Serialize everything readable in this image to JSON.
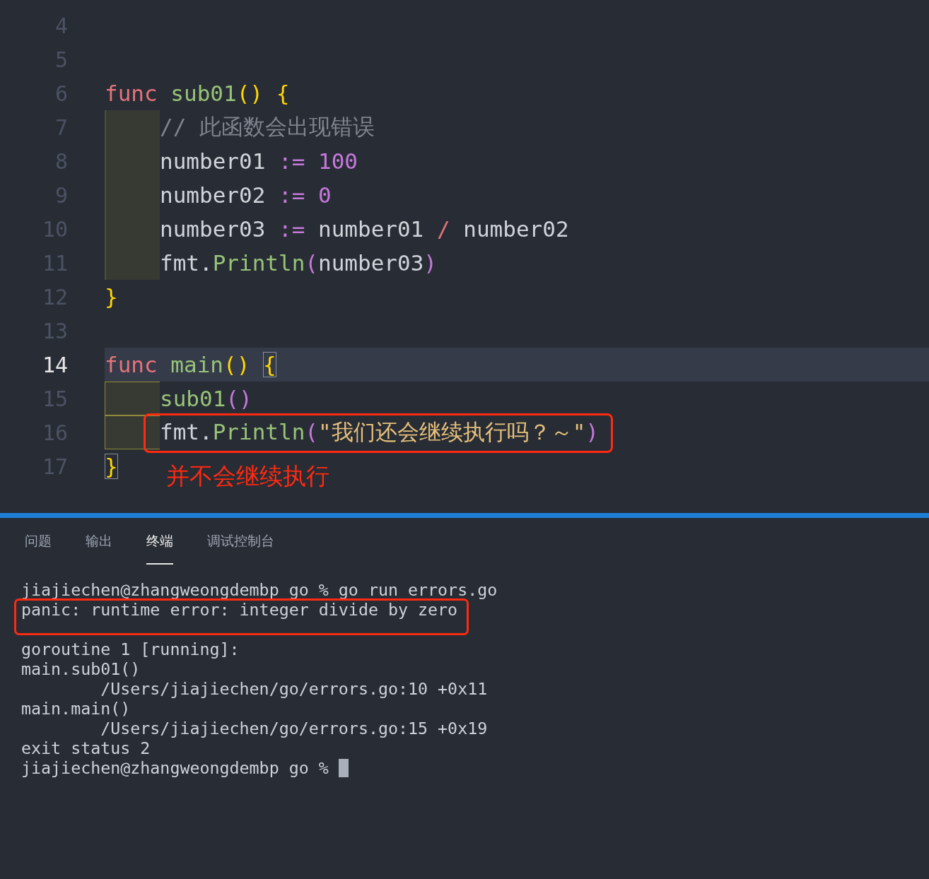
{
  "editor": {
    "lines": [
      {
        "number": "4"
      },
      {
        "number": "5"
      },
      {
        "number": "6",
        "tokens": [
          {
            "kind": "keyword",
            "text": "func "
          },
          {
            "kind": "function",
            "text": "sub01"
          },
          {
            "kind": "paren",
            "text": "() "
          },
          {
            "kind": "brace",
            "text": "{",
            "matched": false
          }
        ]
      },
      {
        "number": "7",
        "indented": true,
        "guide_active": false,
        "tokens": [
          {
            "kind": "comment",
            "text": "// 此函数会出现错误"
          }
        ]
      },
      {
        "number": "8",
        "indented": true,
        "guide_active": false,
        "tokens": [
          {
            "kind": "plain",
            "text": "number01 "
          },
          {
            "kind": "assign",
            "text": ":= "
          },
          {
            "kind": "number",
            "text": "100"
          }
        ]
      },
      {
        "number": "9",
        "indented": true,
        "guide_active": false,
        "tokens": [
          {
            "kind": "plain",
            "text": "number02 "
          },
          {
            "kind": "assign",
            "text": ":= "
          },
          {
            "kind": "number",
            "text": "0"
          }
        ]
      },
      {
        "number": "10",
        "indented": true,
        "guide_active": false,
        "tokens": [
          {
            "kind": "plain",
            "text": "number03 "
          },
          {
            "kind": "assign",
            "text": ":="
          },
          {
            "kind": "plain",
            "text": " number01 "
          },
          {
            "kind": "operator",
            "text": "/"
          },
          {
            "kind": "plain",
            "text": " number02"
          }
        ]
      },
      {
        "number": "11",
        "indented": true,
        "guide_active": false,
        "tokens": [
          {
            "kind": "plain",
            "text": "fmt."
          },
          {
            "kind": "function",
            "text": "Println"
          },
          {
            "kind": "call_paren",
            "text": "("
          },
          {
            "kind": "plain",
            "text": "number03"
          },
          {
            "kind": "call_paren",
            "text": ")"
          }
        ]
      },
      {
        "number": "12",
        "tokens": [
          {
            "kind": "brace",
            "text": "}",
            "matched": false
          }
        ]
      },
      {
        "number": "13"
      },
      {
        "number": "14",
        "current": true,
        "tokens": [
          {
            "kind": "keyword",
            "text": "func "
          },
          {
            "kind": "function",
            "text": "main"
          },
          {
            "kind": "paren",
            "text": "() "
          },
          {
            "kind": "brace",
            "text": "{",
            "matched": true
          }
        ]
      },
      {
        "number": "15",
        "indented": true,
        "guide_active": true,
        "tokens": [
          {
            "kind": "function",
            "text": "sub01"
          },
          {
            "kind": "call_paren",
            "text": "()"
          }
        ]
      },
      {
        "number": "16",
        "indented": true,
        "guide_active": true,
        "boxed": true,
        "tokens": [
          {
            "kind": "plain",
            "text": "fmt."
          },
          {
            "kind": "function",
            "text": "Println"
          },
          {
            "kind": "call_paren",
            "text": "("
          },
          {
            "kind": "string",
            "text": "\"我们还会继续执行吗？～\""
          },
          {
            "kind": "call_paren",
            "text": ")"
          }
        ]
      },
      {
        "number": "17",
        "annotation": "并不会继续执行",
        "tokens": [
          {
            "kind": "brace",
            "text": "}",
            "matched": true
          }
        ]
      }
    ]
  },
  "panel": {
    "tabs": [
      {
        "label": "问题",
        "selected": false
      },
      {
        "label": "输出",
        "selected": false
      },
      {
        "label": "终端",
        "selected": true
      },
      {
        "label": "调试控制台",
        "selected": false
      }
    ],
    "terminal": [
      {
        "text": "jiajiechen@zhangweongdembp go % go run errors.go"
      },
      {
        "text": "panic: runtime error: integer divide by zero",
        "boxed": true
      },
      {
        "text": "goroutine 1 [running]:"
      },
      {
        "text": "main.sub01()"
      },
      {
        "text": "        /Users/jiajiechen/go/errors.go:10 +0x11"
      },
      {
        "text": "main.main()"
      },
      {
        "text": "        /Users/jiajiechen/go/errors.go:15 +0x19"
      },
      {
        "text": "exit status 2"
      },
      {
        "text": "jiajiechen@zhangweongdembp go % ",
        "cursor": true
      }
    ]
  }
}
